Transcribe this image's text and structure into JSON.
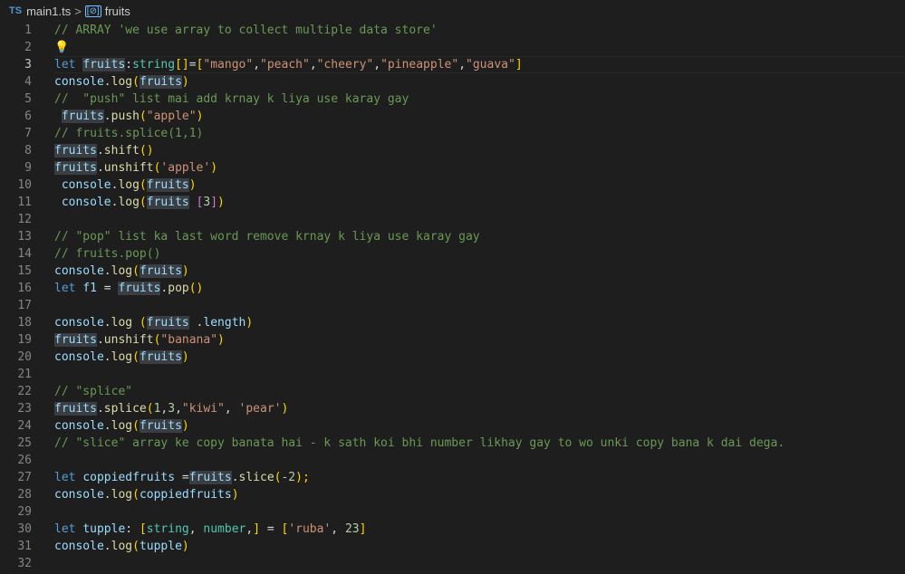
{
  "breadcrumb": {
    "file_badge": "TS",
    "file_name": "main1.ts",
    "separator": ">",
    "symbol_name": "fruits"
  },
  "editor": {
    "current_line": 3,
    "lines": [
      {
        "n": "1"
      },
      {
        "n": "2"
      },
      {
        "n": "3"
      },
      {
        "n": "4"
      },
      {
        "n": "5"
      },
      {
        "n": "6"
      },
      {
        "n": "7"
      },
      {
        "n": "8"
      },
      {
        "n": "9"
      },
      {
        "n": "10"
      },
      {
        "n": "11"
      },
      {
        "n": "12"
      },
      {
        "n": "13"
      },
      {
        "n": "14"
      },
      {
        "n": "15"
      },
      {
        "n": "16"
      },
      {
        "n": "17"
      },
      {
        "n": "18"
      },
      {
        "n": "19"
      },
      {
        "n": "20"
      },
      {
        "n": "21"
      },
      {
        "n": "22"
      },
      {
        "n": "23"
      },
      {
        "n": "24"
      },
      {
        "n": "25"
      },
      {
        "n": "26"
      },
      {
        "n": "27"
      },
      {
        "n": "28"
      },
      {
        "n": "29"
      },
      {
        "n": "30"
      },
      {
        "n": "31"
      },
      {
        "n": "32"
      }
    ],
    "tokens": {
      "l1": "// ARRAY 'we use array to collect multiple data store'",
      "l2_bulb": "💡",
      "l3": [
        "let",
        " ",
        "fr",
        "uits",
        ":",
        "string",
        "[]",
        "=",
        "[",
        "\"mango\"",
        ",",
        "\"peach\"",
        ",",
        "\"cheery\"",
        ",",
        "\"pineapple\"",
        ",",
        "\"guava\"",
        "]"
      ],
      "l4": [
        "console",
        ".",
        "log",
        "(",
        "fruits",
        ")"
      ],
      "l5": "//  \"push\" list mai add krnay k liya use karay gay",
      "l6": [
        " ",
        "fruits",
        ".",
        "push",
        "(",
        "\"apple\"",
        ")"
      ],
      "l7": "// fruits.splice(1,1)",
      "l8": [
        "fruits",
        ".",
        "shift",
        "()"
      ],
      "l9": [
        "fruits",
        ".",
        "unshift",
        "(",
        "'apple'",
        ")"
      ],
      "l10": [
        " ",
        "console",
        ".",
        "log",
        "(",
        "fruits",
        ")"
      ],
      "l11": [
        " ",
        "console",
        ".",
        "log",
        "(",
        "fruits",
        " ",
        "[",
        "3",
        "]",
        ")"
      ],
      "l13": "// \"pop\" list ka last word remove krnay k liya use karay gay",
      "l14": "// fruits.pop()",
      "l15": [
        "console",
        ".",
        "log",
        "(",
        "fruits",
        ")"
      ],
      "l16": [
        "let",
        " ",
        "f1",
        " = ",
        "fruits",
        ".",
        "pop",
        "()"
      ],
      "l18": [
        "console",
        ".",
        "log",
        " (",
        "fruits",
        " .",
        "length",
        ")"
      ],
      "l19": [
        "fruits",
        ".",
        "unshift",
        "(",
        "\"banana\"",
        ")"
      ],
      "l20": [
        "console",
        ".",
        "log",
        "(",
        "fruits",
        ")"
      ],
      "l22": "// \"splice\"",
      "l23": [
        "fruits",
        ".",
        "splice",
        "(",
        "1",
        ",",
        "3",
        ",",
        "\"kiwi\"",
        ", ",
        "'pear'",
        ")"
      ],
      "l24": [
        "console",
        ".",
        "log",
        "(",
        "fruits",
        ")"
      ],
      "l25": "// \"slice\" array ke copy banata hai - k sath koi bhi number likhay gay to wo unki copy bana k dai dega.",
      "l27": [
        "let",
        " ",
        "coppiedfruits",
        " =",
        "fruits",
        ".",
        "slice",
        "(",
        "-2",
        ");"
      ],
      "l28": [
        "console",
        ".",
        "log",
        "(",
        "coppiedfruits",
        ")"
      ],
      "l30": [
        "let",
        " ",
        "tupple",
        ": ",
        "[",
        "string",
        ", ",
        "number",
        ",",
        "]",
        " = ",
        "[",
        "'ruba'",
        ", ",
        "23",
        "]"
      ],
      "l31": [
        "console",
        ".",
        "log",
        "(",
        "tupple",
        ")"
      ]
    }
  }
}
